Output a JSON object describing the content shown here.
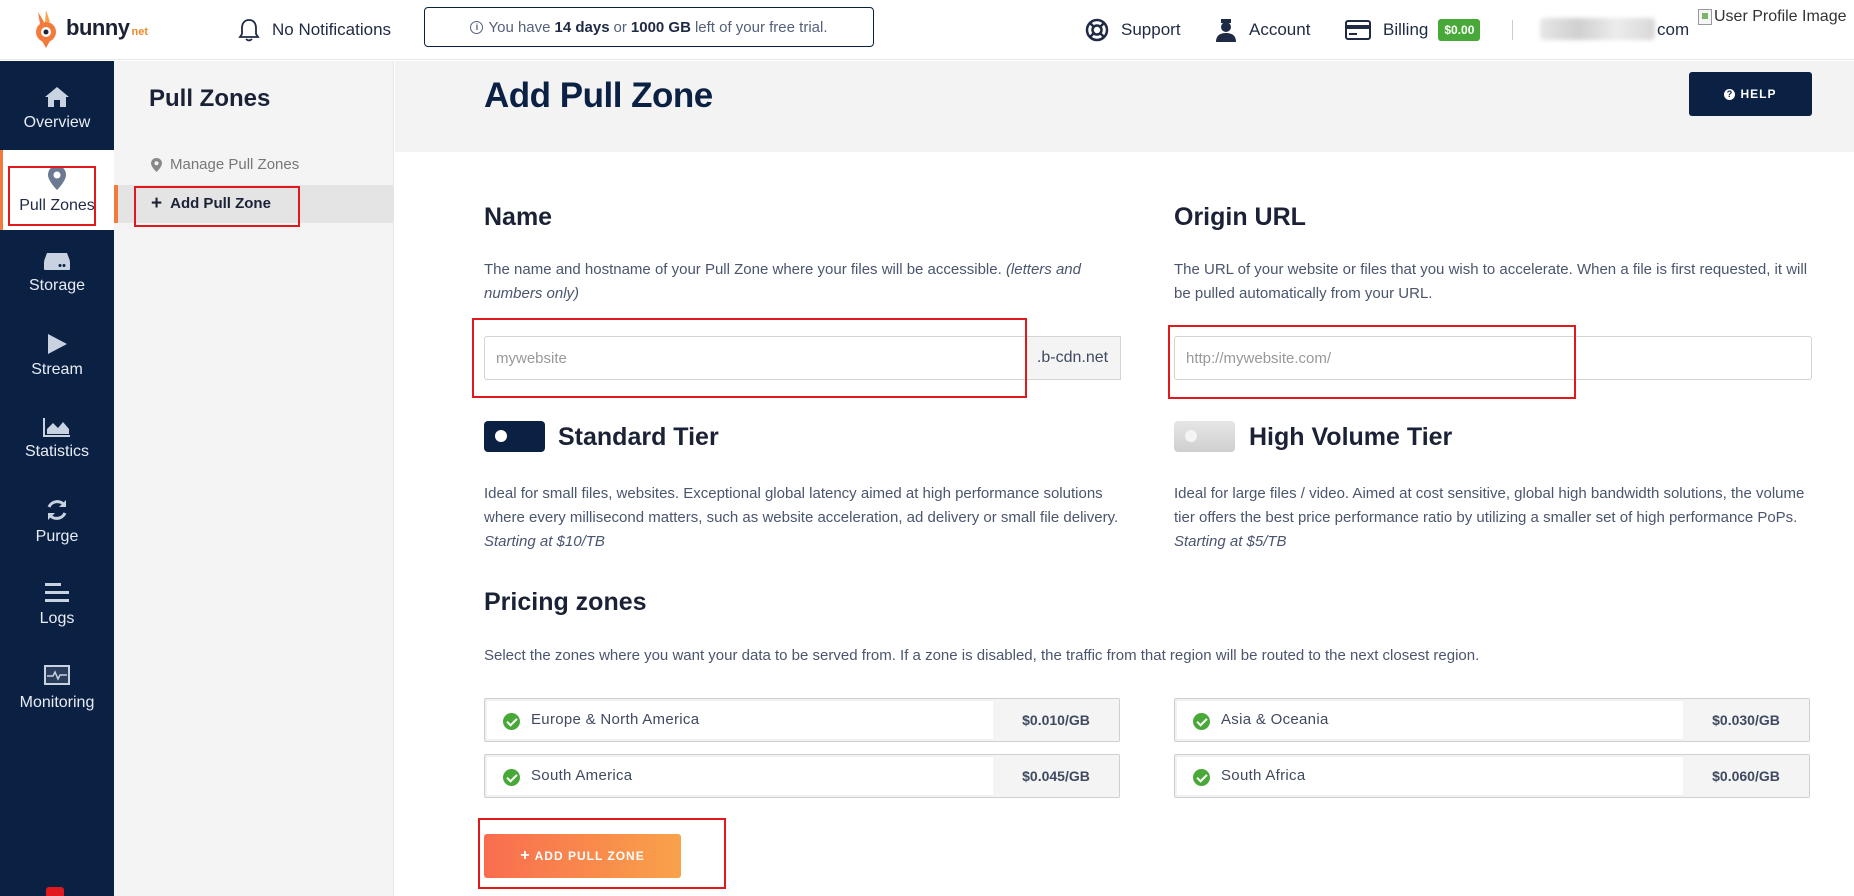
{
  "topbar": {
    "logo_text": "bunny",
    "logo_suffix": "net",
    "notifications": "No Notifications",
    "trial_prefix": "You have",
    "trial_days": "14 days",
    "trial_mid": "or",
    "trial_gb": "1000 GB",
    "trial_suffix": "left of your free trial.",
    "support": "Support",
    "account": "Account",
    "billing": "Billing",
    "billing_amount": "$0.00",
    "email_suffix": "com",
    "profile_alt": "User Profile Image"
  },
  "leftnav": {
    "items": [
      {
        "label": "Overview",
        "icon": "home-icon"
      },
      {
        "label": "Pull Zones",
        "icon": "location-pin-icon"
      },
      {
        "label": "Storage",
        "icon": "storage-drive-icon"
      },
      {
        "label": "Stream",
        "icon": "play-icon"
      },
      {
        "label": "Statistics",
        "icon": "area-chart-icon"
      },
      {
        "label": "Purge",
        "icon": "refresh-icon"
      },
      {
        "label": "Logs",
        "icon": "list-icon"
      },
      {
        "label": "Monitoring",
        "icon": "monitor-icon"
      }
    ]
  },
  "subnav": {
    "title": "Pull Zones",
    "manage_label": "Manage Pull Zones",
    "add_label": "Add Pull Zone"
  },
  "main": {
    "title": "Add Pull Zone",
    "help_label": "HELP",
    "name": {
      "heading": "Name",
      "desc": "The name and hostname of your Pull Zone where your files will be accessible.",
      "desc_italic": "(letters and numbers only)",
      "placeholder": "mywebsite",
      "addon": ".b-cdn.net"
    },
    "origin": {
      "heading": "Origin URL",
      "desc": "The URL of your website or files that you wish to accelerate. When a file is first requested, it will be pulled automatically from your URL.",
      "placeholder": "http://mywebsite.com/"
    },
    "standard": {
      "title": "Standard Tier",
      "enabled": true,
      "desc": "Ideal for small files, websites. Exceptional global latency aimed at high performance solutions where every millisecond matters, such as website acceleration, ad delivery or small file delivery.",
      "desc_italic": "Starting at $10/TB"
    },
    "volume": {
      "title": "High Volume Tier",
      "enabled": false,
      "desc": "Ideal for large files / video. Aimed at cost sensitive, global high bandwidth solutions, the volume tier offers the best price performance ratio by utilizing a smaller set of high performance PoPs.",
      "desc_italic": "Starting at $5/TB"
    },
    "pricing": {
      "heading": "Pricing zones",
      "desc": "Select the zones where you want your data to be served from. If a zone is disabled, the traffic from that region will be routed to the next closest region.",
      "zones": [
        {
          "name": "Europe & North America",
          "price": "$0.010/GB"
        },
        {
          "name": "Asia & Oceania",
          "price": "$0.030/GB"
        },
        {
          "name": "South America",
          "price": "$0.045/GB"
        },
        {
          "name": "South Africa",
          "price": "$0.060/GB"
        }
      ]
    },
    "add_button": "ADD PULL ZONE"
  },
  "colors": {
    "navy": "#0b2144",
    "accent_orange": "#f27a3b",
    "success_green": "#48a938",
    "highlight_red": "#e0191d"
  }
}
